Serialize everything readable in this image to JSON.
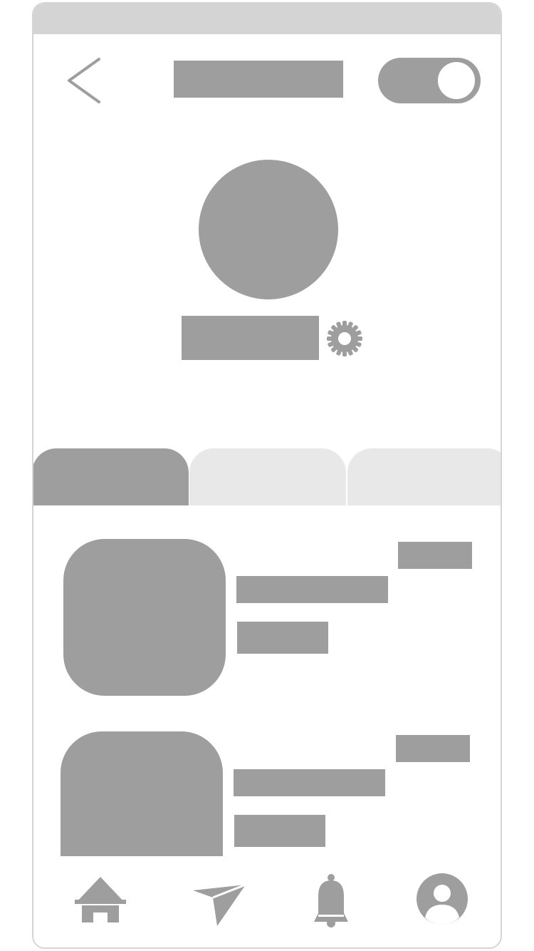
{
  "screen": {
    "accent_color": "#9e9e9e",
    "frame_color": "#d4d4d4",
    "tab_inactive_color": "#e8e8e8"
  },
  "header": {
    "back_icon": "chevron-left-icon",
    "title": "",
    "toggle": {
      "state": "on"
    }
  },
  "profile": {
    "name": "",
    "settings_icon": "gear-icon"
  },
  "tabs": [
    {
      "label": "",
      "active": true
    },
    {
      "label": "",
      "active": false
    },
    {
      "label": "",
      "active": false
    }
  ],
  "items": [
    {
      "title": "",
      "subtitle": "",
      "meta": ""
    },
    {
      "title": "",
      "subtitle": "",
      "meta": ""
    }
  ],
  "bottom_nav": [
    {
      "icon": "home-icon"
    },
    {
      "icon": "send-icon"
    },
    {
      "icon": "bell-icon"
    },
    {
      "icon": "user-icon"
    }
  ]
}
